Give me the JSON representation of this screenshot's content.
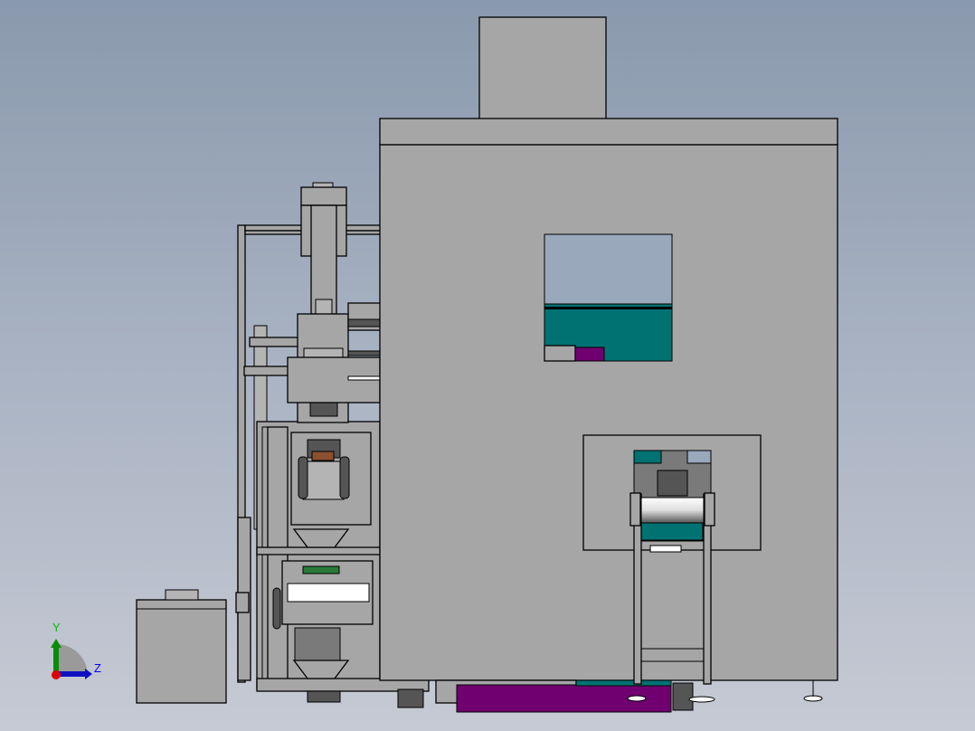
{
  "viewport": {
    "background_top": "#8a99ad",
    "background_bottom": "#c6cad4"
  },
  "model_colors": {
    "body": "#a6a6a6",
    "accent_teal": "#007272",
    "accent_purple": "#700070"
  },
  "triad": {
    "y_label": "Y",
    "z_label": "Z",
    "y_color": "#00c000",
    "z_color": "#0000ff",
    "x_color": "#e00000"
  }
}
